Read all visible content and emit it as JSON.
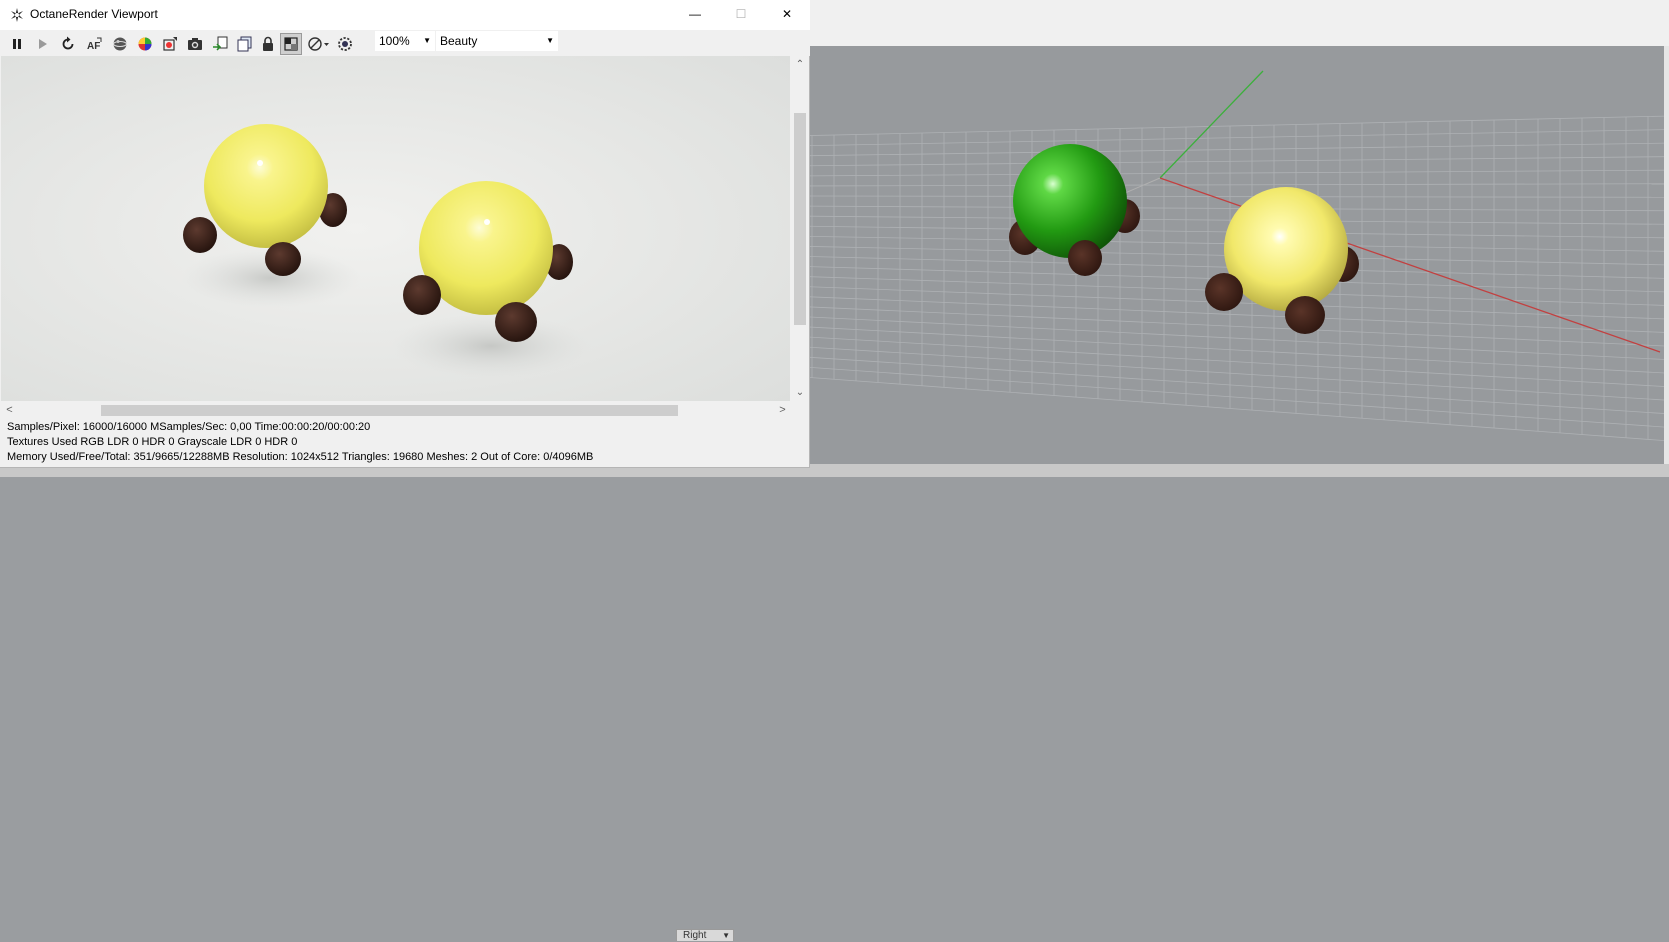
{
  "window": {
    "title": "OctaneRender Viewport",
    "minimize_glyph": "—",
    "maximize_glyph": "☐",
    "close_glyph": "✕"
  },
  "toolbar": {
    "buttons": [
      "pause-icon",
      "play-icon",
      "restart-icon",
      "af-icon",
      "sphere-icon",
      "color-picker-icon",
      "material-picker-icon",
      "camera-icon",
      "export-icon",
      "copy-icon",
      "lock-icon",
      "region-icon",
      "filter-icon",
      "settings-icon"
    ],
    "zoom": "100%",
    "render_pass": "Beauty"
  },
  "scroll": {
    "up": "⌃",
    "down": "⌄",
    "left": "<",
    "right": ">"
  },
  "status": {
    "line1": "Samples/Pixel: 16000/16000  MSamples/Sec: 0,00  Time:00:00:20/00:00:20",
    "line2": "Textures Used RGB LDR 0  HDR 0  Grayscale LDR 0  HDR 0",
    "line3": "Memory Used/Free/Total: 351/9665/12288MB  Resolution: 1024x512  Triangles: 19680  Meshes: 2 Out of Core: 0/4096MB"
  },
  "rhino": {
    "viewport_tab": "Right"
  },
  "colors": {
    "yellow": "#f3ef6a",
    "green": "#2ea81a",
    "wheel": "#3a2018",
    "axis_x": "#c03a3a",
    "axis_y": "#38b038"
  }
}
